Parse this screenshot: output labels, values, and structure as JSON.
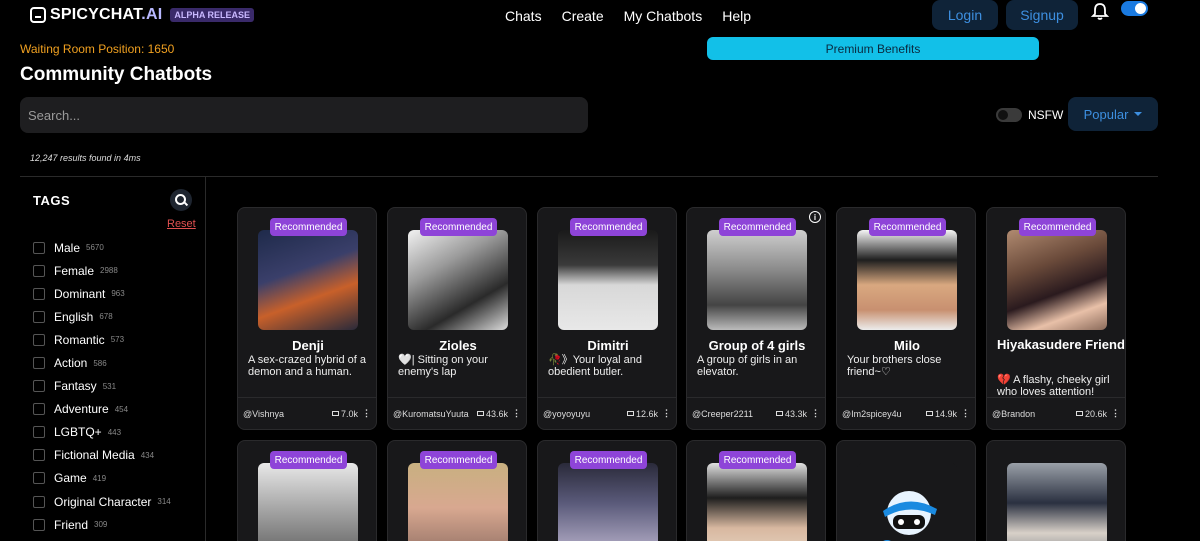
{
  "header": {
    "logo_main": "SPICYCHAT",
    "logo_ai": ".AI",
    "alpha_badge": "ALPHA RELEASE",
    "nav": [
      "Chats",
      "Create",
      "My Chatbots",
      "Help"
    ],
    "login_label": "Login",
    "signup_label": "Signup"
  },
  "waiting_room": "Waiting Room Position: 1650",
  "premium_label": "Premium Benefits",
  "page_title": "Community Chatbots",
  "search": {
    "placeholder": "Search..."
  },
  "nsfw_label": "NSFW",
  "sort_label": "Popular",
  "results_text": "12,247 results found in 4ms",
  "sidebar": {
    "title": "TAGS",
    "reset_label": "Reset",
    "tags": [
      {
        "label": "Male",
        "count": "5670"
      },
      {
        "label": "Female",
        "count": "2988"
      },
      {
        "label": "Dominant",
        "count": "963"
      },
      {
        "label": "English",
        "count": "678"
      },
      {
        "label": "Romantic",
        "count": "573"
      },
      {
        "label": "Action",
        "count": "586"
      },
      {
        "label": "Fantasy",
        "count": "531"
      },
      {
        "label": "Adventure",
        "count": "454"
      },
      {
        "label": "LGBTQ+",
        "count": "443"
      },
      {
        "label": "Fictional Media",
        "count": "434"
      },
      {
        "label": "Game",
        "count": "419"
      },
      {
        "label": "Original Character",
        "count": "314"
      },
      {
        "label": "Friend",
        "count": "309"
      }
    ]
  },
  "cards_row1": [
    {
      "badge": "Recommended",
      "name": "Denji",
      "desc": "A sex-crazed hybrid of a demon and a human.",
      "author": "@Vishnya",
      "count": "7.0k"
    },
    {
      "badge": "Recommended",
      "name": "Zioles",
      "desc": "🤍| Sitting on your enemy's lap",
      "author": "@KuromatsuYuuta",
      "count": "43.6k"
    },
    {
      "badge": "Recommended",
      "name": "Dimitri",
      "desc": "🥀》Your loyal and obedient butler.",
      "author": "@yoyoyuyu",
      "count": "12.6k"
    },
    {
      "badge": "Recommended",
      "name": "Group of 4 girls",
      "desc": "A group of girls in an elevator.",
      "author": "@Creeper2211",
      "count": "43.3k"
    },
    {
      "badge": "Recommended",
      "name": "Milo",
      "desc": "Your brothers close friend~♡",
      "author": "@Im2spicey4u",
      "count": "14.9k"
    },
    {
      "badge": "Recommended",
      "name": "Hiyakasudere Friend",
      "desc": "💔 A flashy, cheeky girl who loves attention!",
      "author": "@Brandon",
      "count": "20.6k"
    }
  ],
  "cards_row2": [
    {
      "badge": "Recommended"
    },
    {
      "badge": "Recommended"
    },
    {
      "badge": "Recommended"
    },
    {
      "badge": "Recommended"
    },
    {
      "badge": ""
    },
    {
      "badge": ""
    }
  ],
  "icons": [
    "chat-logo-icon",
    "bell-icon",
    "theme-toggle-icon",
    "search-icon",
    "caret-down-icon",
    "message-icon",
    "more-dots-icon",
    "info-icon"
  ],
  "colors": {
    "accent_blue": "#3d8fe0",
    "premium": "#12c0e8",
    "badge_purple": "#8e44d8",
    "waiting": "#f0a020",
    "reset": "#e05050"
  }
}
